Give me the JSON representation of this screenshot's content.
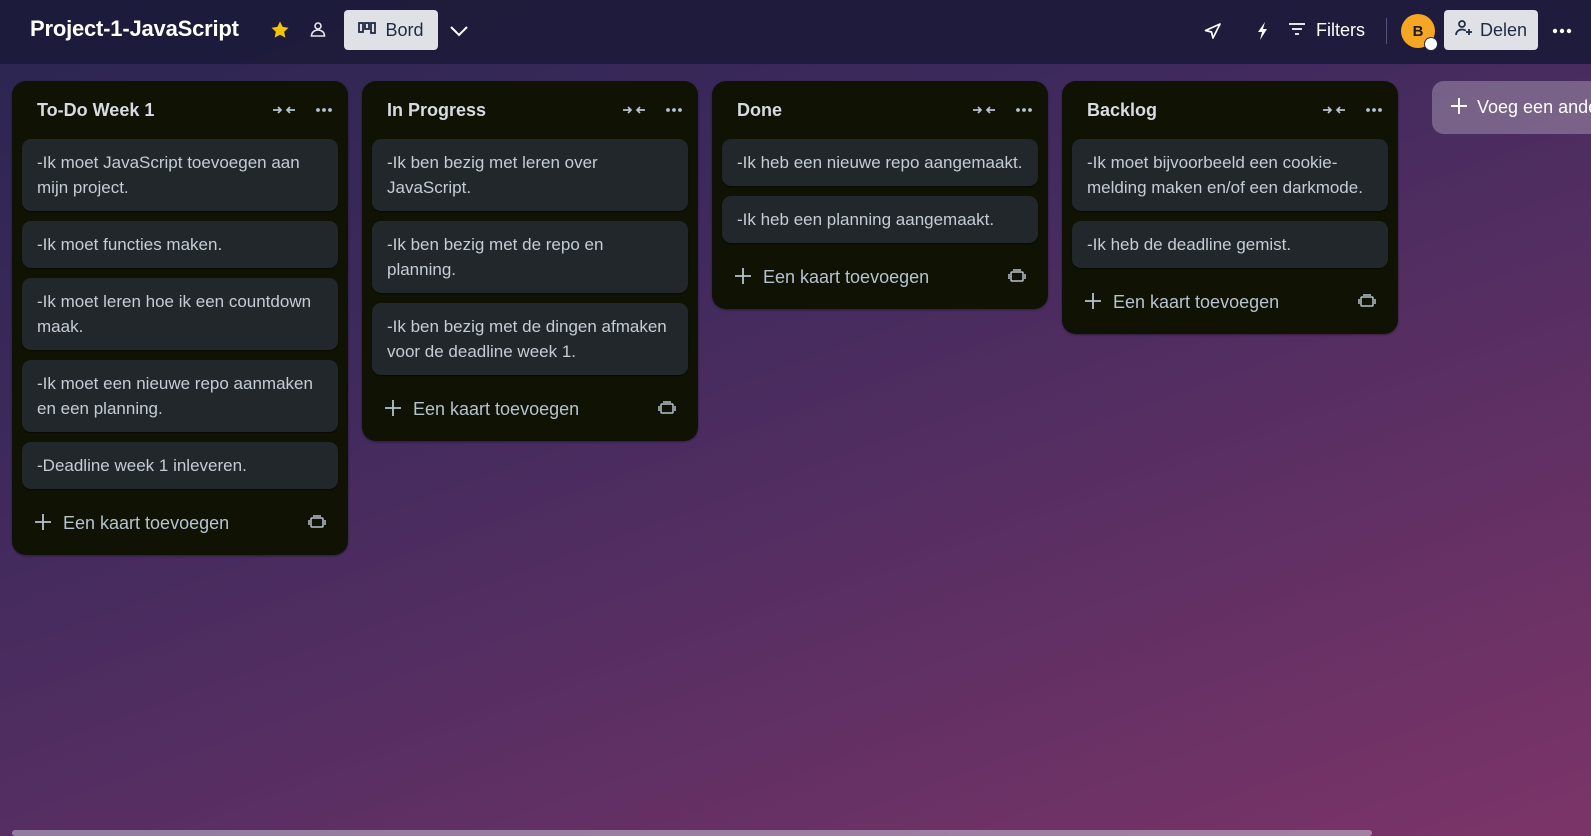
{
  "header": {
    "board_title": "Project-1-JavaScript",
    "view_label": "Bord",
    "filters_label": "Filters",
    "avatar_initial": "B",
    "share_label": "Delen"
  },
  "lists": [
    {
      "title": "To-Do Week 1",
      "cards": [
        "-Ik moet JavaScript toevoegen aan mijn project.",
        "-Ik moet functies maken.",
        "-Ik moet leren hoe ik een countdown maak.",
        "-Ik moet een nieuwe repo aanmaken en een planning.",
        "-Deadline week 1 inleveren."
      ],
      "add_card_label": "Een kaart toevoegen"
    },
    {
      "title": "In Progress",
      "cards": [
        "-Ik ben bezig met leren over JavaScript.",
        "-Ik ben bezig met de repo en planning.",
        "-Ik ben bezig met de dingen afmaken voor de deadline week 1."
      ],
      "add_card_label": "Een kaart toevoegen"
    },
    {
      "title": "Done",
      "cards": [
        "-Ik heb een nieuwe repo aangemaakt.",
        "-Ik heb een planning aangemaakt."
      ],
      "add_card_label": "Een kaart toevoegen"
    },
    {
      "title": "Backlog",
      "cards": [
        "-Ik moet bijvoorbeeld een cookie-melding maken en/of een darkmode.",
        "-Ik heb de deadline gemist."
      ],
      "add_card_label": "Een kaart toevoegen"
    }
  ],
  "add_list_label": "Voeg een ande",
  "colors": {
    "list_background": "#101204",
    "card_background": "#22272b",
    "star": "#f5c400",
    "avatar": "#f5a623"
  }
}
